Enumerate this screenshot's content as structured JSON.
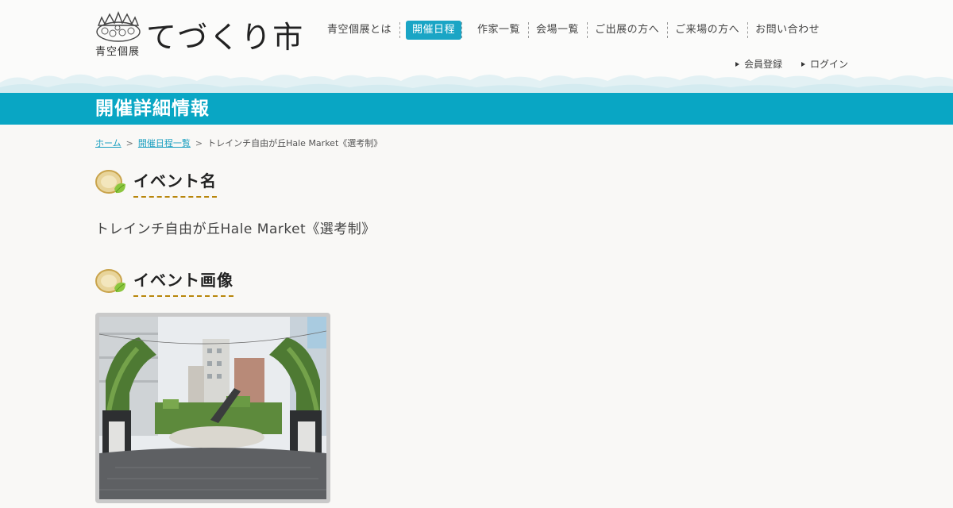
{
  "brand": {
    "sub": "青空個展",
    "title": "てづくり市"
  },
  "nav": [
    {
      "label": "青空個展とは",
      "active": false
    },
    {
      "label": "開催日程",
      "active": true
    },
    {
      "label": "作家一覧",
      "active": false
    },
    {
      "label": "会場一覧",
      "active": false
    },
    {
      "label": "ご出展の方へ",
      "active": false
    },
    {
      "label": "ご来場の方へ",
      "active": false
    },
    {
      "label": "お問い合わせ",
      "active": false
    }
  ],
  "subnav": [
    {
      "label": "会員登録"
    },
    {
      "label": "ログイン"
    }
  ],
  "page_title": "開催詳細情報",
  "breadcrumb": [
    {
      "label": "ホーム",
      "link": true
    },
    {
      "label": "開催日程一覧",
      "link": true
    },
    {
      "label": "トレインチ自由が丘Hale Market《選考制》",
      "link": false
    }
  ],
  "breadcrumb_sep": ">",
  "sections": {
    "event_name": {
      "heading": "イベント名",
      "value": "トレインチ自由が丘Hale Market《選考制》"
    },
    "event_image": {
      "heading": "イベント画像"
    }
  },
  "colors": {
    "accent": "#09a6c4",
    "nav_active": "#1aa5c5",
    "background": "#f9f8f6",
    "underline": "#b8860b"
  }
}
